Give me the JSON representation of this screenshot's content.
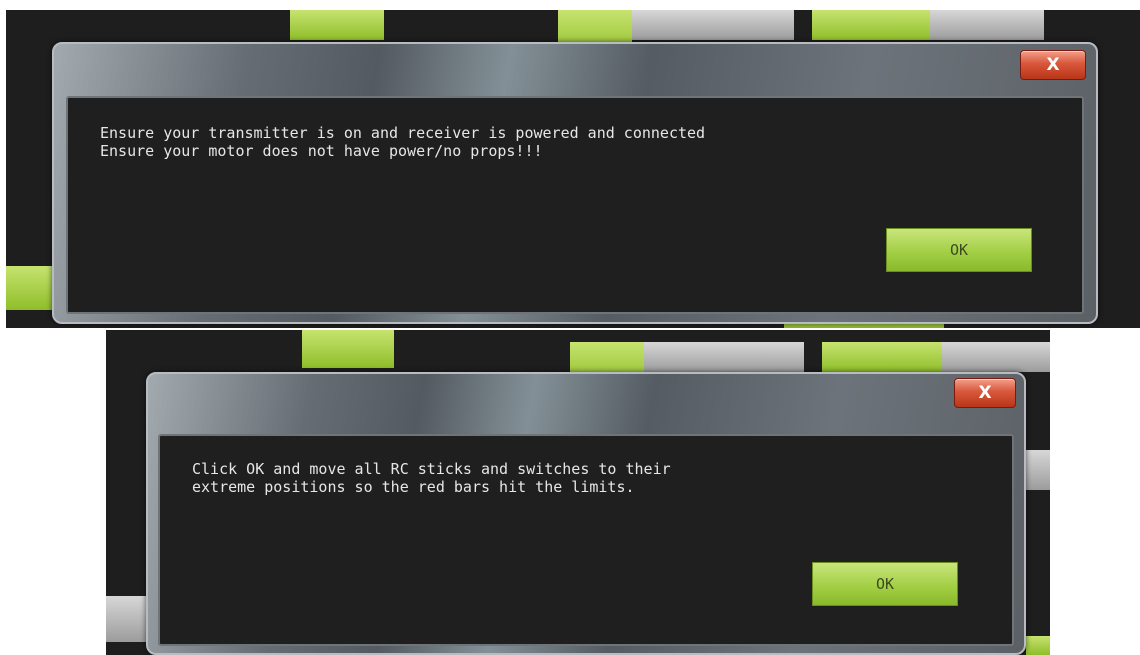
{
  "dialogs": [
    {
      "close_label": "X",
      "lines": [
        "Ensure your transmitter is on and receiver is powered and connected",
        "Ensure your motor does not have power/no props!!!"
      ],
      "message": "Ensure your transmitter is on and receiver is powered and connected\nEnsure your motor does not have power/no props!!!",
      "ok_label": "OK"
    },
    {
      "close_label": "X",
      "lines": [
        "Click OK and move all RC sticks and switches to their",
        "extreme positions so the red bars hit the limits."
      ],
      "message": "Click OK and move all RC sticks and switches to their\nextreme positions so the red bars hit the limits.",
      "ok_label": "OK"
    }
  ],
  "colors": {
    "accent_green": "#a3cf45",
    "close_red": "#d9573b",
    "dialog_body": "#1f1f1f",
    "page_bg": "#1e1e1e",
    "text": "#e6e6e6"
  },
  "icons": [
    "close-icon"
  ]
}
